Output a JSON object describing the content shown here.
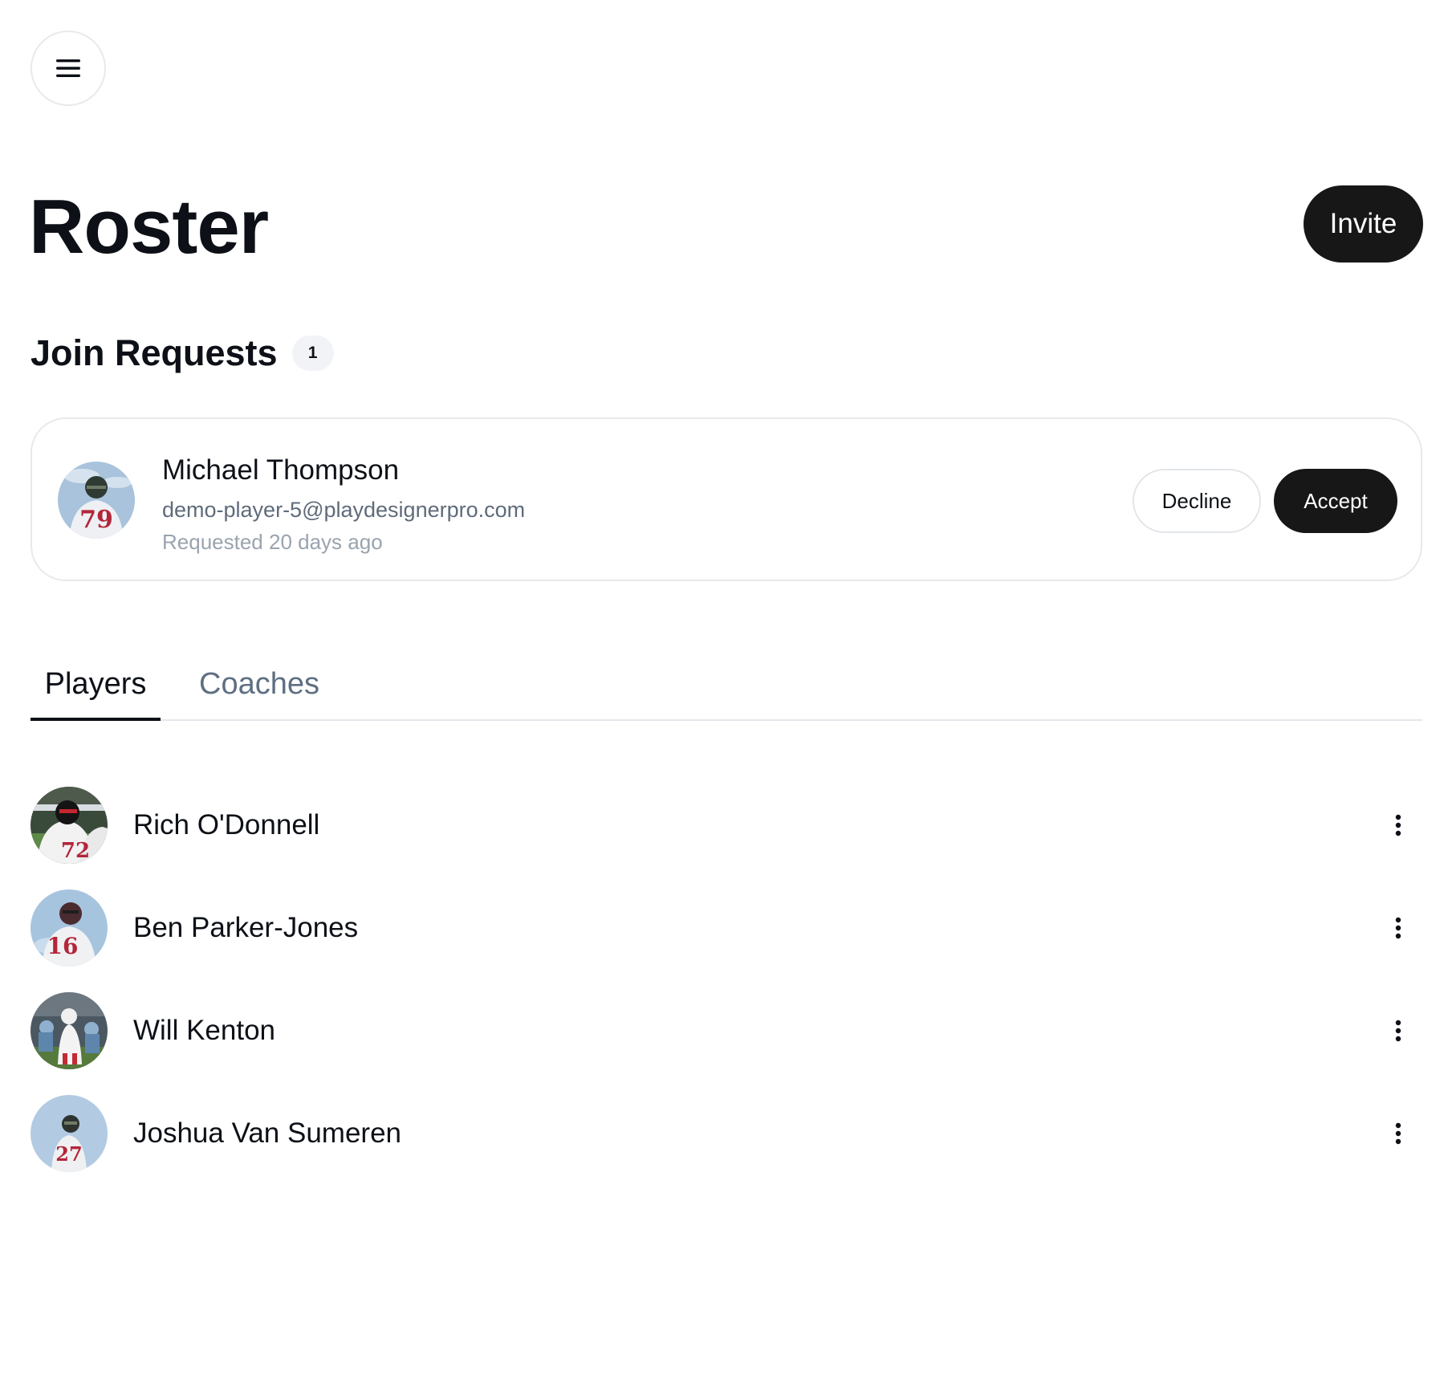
{
  "header": {
    "menu_icon": "hamburger-menu-icon",
    "title": "Roster",
    "invite_label": "Invite"
  },
  "join_requests": {
    "title": "Join Requests",
    "count": "1",
    "items": [
      {
        "name": "Michael Thompson",
        "email": "demo-player-5@playdesignerpro.com",
        "requested": "Requested 20 days ago",
        "jersey": "79",
        "decline_label": "Decline",
        "accept_label": "Accept"
      }
    ]
  },
  "tabs": [
    {
      "label": "Players",
      "active": true
    },
    {
      "label": "Coaches",
      "active": false
    }
  ],
  "players": [
    {
      "name": "Rich O'Donnell",
      "jersey": "72",
      "menu_icon": "more-vertical-icon"
    },
    {
      "name": "Ben Parker-Jones",
      "jersey": "16",
      "menu_icon": "more-vertical-icon"
    },
    {
      "name": "Will Kenton",
      "jersey": "",
      "menu_icon": "more-vertical-icon"
    },
    {
      "name": "Joshua Van Sumeren",
      "jersey": "27",
      "menu_icon": "more-vertical-icon"
    }
  ],
  "colors": {
    "primary_button": "#171717",
    "border": "#e7e9ec",
    "muted_text": "#5f6b7a",
    "inactive_tab": "#5f6f82",
    "jersey_number": "#b3263a"
  }
}
